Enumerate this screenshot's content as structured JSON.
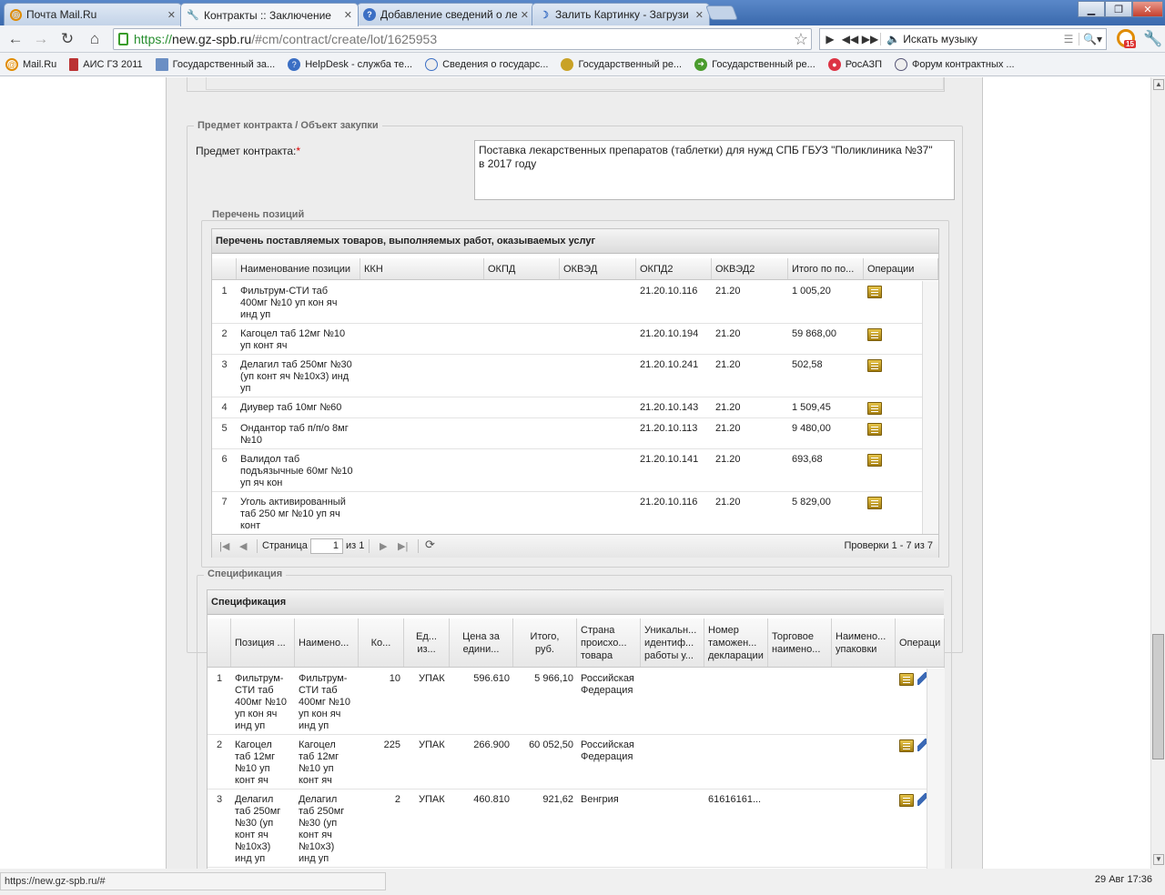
{
  "browser": {
    "tabs": [
      {
        "title": "Почта Mail.Ru",
        "icon": "mail-icon"
      },
      {
        "title": "Контракты :: Заключение",
        "icon": "tools-icon"
      },
      {
        "title": "Добавление сведений о ле",
        "icon": "help-icon"
      },
      {
        "title": "Залить Картинку - Загрузи",
        "icon": "moon-icon"
      }
    ],
    "url_scheme": "https://",
    "url_host": "new.gz-spb.ru",
    "url_path": "/#cm/contract/create/lot/1625953",
    "music_placeholder": "Искать музыку",
    "badge": "15",
    "bookmarks": [
      "Mail.Ru",
      "АИС ГЗ 2011",
      "Государственный за...",
      "HelpDesk - служба те...",
      "Сведения о государс...",
      "Государственный ре...",
      "Государственный ре...",
      "РосАЗП",
      "Форум контрактных ..."
    ],
    "status_url": "https://new.gz-spb.ru/#",
    "clock": "29 Авг 17:36"
  },
  "subject": {
    "legend": "Предмет контракта / Объект закупки",
    "label": "Предмет контракта:",
    "required": "*",
    "value_line1": "Поставка лекарственных препаратов (таблетки) для нужд СПБ ГБУЗ \"Поликлиника №37\"",
    "value_line2": "в 2017 году"
  },
  "positions": {
    "legend": "Перечень позиций",
    "title": "Перечень поставляемых товаров, выполняемых работ, оказываемых услуг",
    "columns": [
      "Наименование позиции",
      "ККН",
      "ОКПД",
      "ОКВЭД",
      "ОКПД2",
      "ОКВЭД2",
      "Итого по по...",
      "Операции"
    ],
    "rows": [
      {
        "n": "1",
        "name1": "Фильтрум-СТИ таб",
        "name2": "400мг №10 уп кон яч",
        "name3": "инд уп",
        "okpd2": "21.20.10.116",
        "okved2": "21.20",
        "total": "1 005,20"
      },
      {
        "n": "2",
        "name1": "Кагоцел таб 12мг №10",
        "name2": "уп конт яч",
        "name3": "",
        "okpd2": "21.20.10.194",
        "okved2": "21.20",
        "total": "59 868,00"
      },
      {
        "n": "3",
        "name1": "Делагил таб 250мг №30",
        "name2": "(уп конт яч №10х3) инд",
        "name3": "уп",
        "okpd2": "21.20.10.241",
        "okved2": "21.20",
        "total": "502,58"
      },
      {
        "n": "4",
        "name1": "Диувер таб 10мг №60",
        "name2": "",
        "name3": "",
        "okpd2": "21.20.10.143",
        "okved2": "21.20",
        "total": "1 509,45"
      },
      {
        "n": "5",
        "name1": "Ондантор таб п/п/о 8мг",
        "name2": "№10",
        "name3": "",
        "okpd2": "21.20.10.113",
        "okved2": "21.20",
        "total": "9 480,00"
      },
      {
        "n": "6",
        "name1": "Валидол таб",
        "name2": "подъязычные 60мг №10",
        "name3": "уп яч кон",
        "okpd2": "21.20.10.141",
        "okved2": "21.20",
        "total": "693,68"
      },
      {
        "n": "7",
        "name1": "Уголь активированный",
        "name2": "таб 250 мг №10 уп яч",
        "name3": "конт",
        "okpd2": "21.20.10.116",
        "okved2": "21.20",
        "total": "5 829,00"
      }
    ],
    "pager": {
      "page_label": "Страница",
      "page": "1",
      "of": "из 1",
      "summary": "Проверки 1 - 7 из 7"
    }
  },
  "spec": {
    "legend": "Спецификация",
    "title": "Спецификация",
    "columns": [
      {
        "l1": "Позиция ...",
        "l2": "",
        "l3": ""
      },
      {
        "l1": "Наимено...",
        "l2": "",
        "l3": ""
      },
      {
        "l1": "Ко...",
        "l2": "",
        "l3": ""
      },
      {
        "l1": "Ед...",
        "l2": "из...",
        "l3": ""
      },
      {
        "l1": "Цена за",
        "l2": "едини...",
        "l3": ""
      },
      {
        "l1": "Итого,",
        "l2": "руб.",
        "l3": ""
      },
      {
        "l1": "Страна",
        "l2": "происхо...",
        "l3": "товара"
      },
      {
        "l1": "Уникальн...",
        "l2": "идентиф...",
        "l3": "работы у..."
      },
      {
        "l1": "Номер",
        "l2": "таможен...",
        "l3": "декларации"
      },
      {
        "l1": "Торговое",
        "l2": "наимено...",
        "l3": ""
      },
      {
        "l1": "Наимено...",
        "l2": "упаковки",
        "l3": ""
      },
      {
        "l1": "Операци",
        "l2": "",
        "l3": ""
      }
    ],
    "rows": [
      {
        "n": "1",
        "pos": [
          "Фильтрум-",
          "СТИ таб",
          "400мг №10",
          "уп кон яч",
          "инд уп"
        ],
        "name": [
          "Фильтрум-",
          "СТИ таб",
          "400мг №10",
          "уп кон яч",
          "инд уп"
        ],
        "qty": "10",
        "unit": "УПАК",
        "price": "596.610",
        "total": "5 966,10",
        "country": [
          "Российская",
          "Федерация"
        ],
        "decl": ""
      },
      {
        "n": "2",
        "pos": [
          "Кагоцел",
          "таб 12мг",
          "№10 уп",
          "конт яч"
        ],
        "name": [
          "Кагоцел",
          "таб 12мг",
          "№10 уп",
          "конт яч"
        ],
        "qty": "225",
        "unit": "УПАК",
        "price": "266.900",
        "total": "60 052,50",
        "country": [
          "Российская",
          "Федерация"
        ],
        "decl": ""
      },
      {
        "n": "3",
        "pos": [
          "Делагил",
          "таб 250мг",
          "№30 (уп",
          "конт яч",
          "№10х3)",
          "инд уп"
        ],
        "name": [
          "Делагил",
          "таб 250мг",
          "№30 (уп",
          "конт яч",
          "№10х3)",
          "инд уп"
        ],
        "qty": "2",
        "unit": "УПАК",
        "price": "460.810",
        "total": "921,62",
        "country": [
          "Венгрия"
        ],
        "decl": "61616161..."
      }
    ]
  }
}
